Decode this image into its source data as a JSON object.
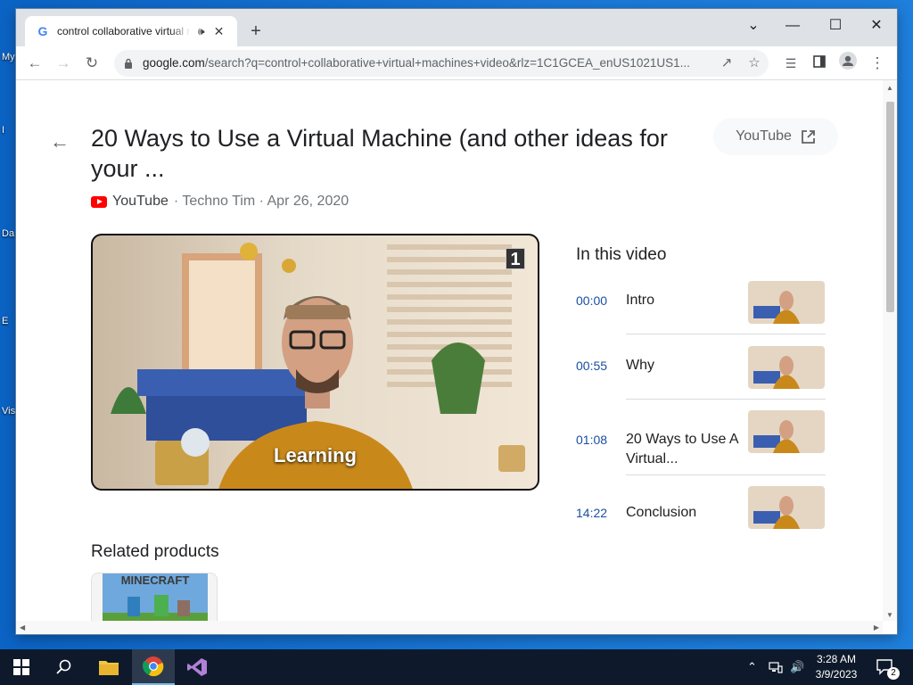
{
  "desktop": {
    "labels": [
      "My",
      "I",
      "Da",
      "E",
      "Vis"
    ]
  },
  "tab": {
    "title": "control collaborative virtual machines video",
    "favicon": "G"
  },
  "toolbar": {
    "url_host": "google.com",
    "url_rest": "/search?q=control+collaborative+virtual+machines+video&rlz=1C1GCEA_enUS1021US1..."
  },
  "result": {
    "title": "20 Ways to Use a Virtual Machine (and other ideas for your ...",
    "source_site": "YouTube",
    "source_rest": " · Techno Tim · Apr 26, 2020",
    "open_chip": "YouTube",
    "player_badge": "1",
    "player_caption": "Learning"
  },
  "chapters": {
    "heading": "In this video",
    "items": [
      {
        "time": "00:00",
        "label": "Intro"
      },
      {
        "time": "00:55",
        "label": "Why"
      },
      {
        "time": "01:08",
        "label": "20 Ways to Use A Virtual..."
      },
      {
        "time": "14:22",
        "label": "Conclusion"
      }
    ]
  },
  "related": {
    "heading": "Related products",
    "product_art_text": "MINECRAFT"
  },
  "taskbar": {
    "time": "3:28 AM",
    "date": "3/9/2023",
    "notifications": "2"
  },
  "colors": {
    "accent": "#1a73e8",
    "youtube_red": "#ff0000",
    "taskbar": "#0e1a2b"
  }
}
